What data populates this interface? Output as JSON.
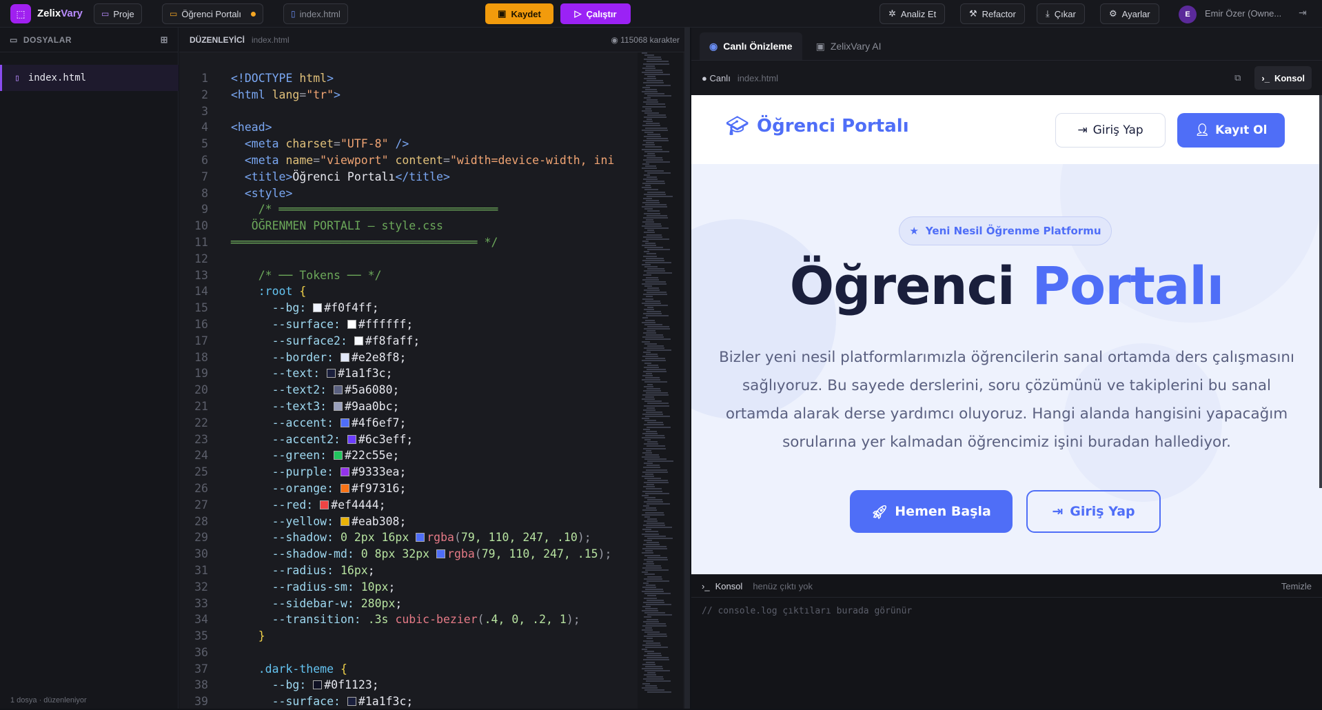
{
  "app": {
    "brand_a": "Zelix",
    "brand_b": "Vary"
  },
  "topbar": {
    "project_label": "Proje",
    "open_project": "Öğrenci Portalı",
    "open_file": "index.html",
    "save_label": "Kaydet",
    "run_label": "Çalıştır",
    "analyze_label": "Analiz Et",
    "refactor_label": "Refactor",
    "export_label": "Çıkar",
    "settings_label": "Ayarlar",
    "user_initial": "E",
    "user_name": "Emir Özer (Owne..."
  },
  "sidebar": {
    "title": "DOSYALAR",
    "files": [
      {
        "name": "index.html"
      }
    ],
    "footer": "1 dosya · düzenleniyor"
  },
  "editor": {
    "title": "DÜZENLEYİCİ",
    "file": "index.html",
    "char_count": "115068 karakter"
  },
  "code_lines": [
    [
      [
        "t-tag",
        "<!DOCTYPE "
      ],
      [
        "t-att",
        "html"
      ],
      [
        "t-tag",
        ">"
      ]
    ],
    [
      [
        "t-tag",
        "<html "
      ],
      [
        "t-att",
        "lang"
      ],
      [
        "t-pun",
        "="
      ],
      [
        "t-str",
        "\"tr\""
      ],
      [
        "t-tag",
        ">"
      ]
    ],
    [],
    [
      [
        "t-tag",
        "<head>"
      ]
    ],
    [
      [
        "t-txt",
        "  "
      ],
      [
        "t-tag",
        "<meta "
      ],
      [
        "t-att",
        "charset"
      ],
      [
        "t-pun",
        "="
      ],
      [
        "t-str",
        "\"UTF-8\""
      ],
      [
        "t-tag",
        " />"
      ]
    ],
    [
      [
        "t-txt",
        "  "
      ],
      [
        "t-tag",
        "<meta "
      ],
      [
        "t-att",
        "name"
      ],
      [
        "t-pun",
        "="
      ],
      [
        "t-str",
        "\"viewport\" "
      ],
      [
        "t-att",
        "content"
      ],
      [
        "t-pun",
        "="
      ],
      [
        "t-str",
        "\"width=device-width, ini"
      ]
    ],
    [
      [
        "t-txt",
        "  "
      ],
      [
        "t-tag",
        "<title>"
      ],
      [
        "t-txt",
        "Öğrenci Portalı"
      ],
      [
        "t-tag",
        "</title>"
      ]
    ],
    [
      [
        "t-txt",
        "  "
      ],
      [
        "t-tag",
        "<style>"
      ]
    ],
    [
      [
        "t-com",
        "    /* ════════════════════════════════"
      ]
    ],
    [
      [
        "t-com",
        "   ÖĞRENMEN PORTALI — style.css"
      ]
    ],
    [
      [
        "t-com",
        "════════════════════════════════════ */"
      ]
    ],
    [],
    [
      [
        "t-com",
        "    /* ── Tokens ── */"
      ]
    ],
    [
      [
        "t-sel",
        "    :root "
      ],
      [
        "t-br",
        "{"
      ]
    ],
    [
      [
        "t-prop",
        "      --bg: "
      ],
      [
        "sw",
        "#f0f4ff"
      ],
      [
        "t-txt",
        "#f0f4ff;"
      ]
    ],
    [
      [
        "t-prop",
        "      --surface: "
      ],
      [
        "sw",
        "#ffffff"
      ],
      [
        "t-txt",
        "#ffffff;"
      ]
    ],
    [
      [
        "t-prop",
        "      --surface2: "
      ],
      [
        "sw",
        "#f8faff"
      ],
      [
        "t-txt",
        "#f8faff;"
      ]
    ],
    [
      [
        "t-prop",
        "      --border: "
      ],
      [
        "sw",
        "#e2e8f8"
      ],
      [
        "t-txt",
        "#e2e8f8;"
      ]
    ],
    [
      [
        "t-prop",
        "      --text: "
      ],
      [
        "sw",
        "#1a1f3c"
      ],
      [
        "t-txt",
        "#1a1f3c;"
      ]
    ],
    [
      [
        "t-prop",
        "      --text2: "
      ],
      [
        "sw",
        "#5a6080"
      ],
      [
        "t-txt",
        "#5a6080;"
      ]
    ],
    [
      [
        "t-prop",
        "      --text3: "
      ],
      [
        "sw",
        "#9aa0bc"
      ],
      [
        "t-txt",
        "#9aa0bc;"
      ]
    ],
    [
      [
        "t-prop",
        "      --accent: "
      ],
      [
        "sw",
        "#4f6ef7"
      ],
      [
        "t-txt",
        "#4f6ef7;"
      ]
    ],
    [
      [
        "t-prop",
        "      --accent2: "
      ],
      [
        "sw",
        "#6c3eff"
      ],
      [
        "t-txt",
        "#6c3eff;"
      ]
    ],
    [
      [
        "t-prop",
        "      --green: "
      ],
      [
        "sw",
        "#22c55e"
      ],
      [
        "t-txt",
        "#22c55e;"
      ]
    ],
    [
      [
        "t-prop",
        "      --purple: "
      ],
      [
        "sw",
        "#9333ea"
      ],
      [
        "t-txt",
        "#9333ea;"
      ]
    ],
    [
      [
        "t-prop",
        "      --orange: "
      ],
      [
        "sw",
        "#f97316"
      ],
      [
        "t-txt",
        "#f97316;"
      ]
    ],
    [
      [
        "t-prop",
        "      --red: "
      ],
      [
        "sw",
        "#ef4444"
      ],
      [
        "t-txt",
        "#ef4444;"
      ]
    ],
    [
      [
        "t-prop",
        "      --yellow: "
      ],
      [
        "sw",
        "#eab308"
      ],
      [
        "t-txt",
        "#eab308;"
      ]
    ],
    [
      [
        "t-prop",
        "      --shadow: "
      ],
      [
        "t-num",
        "0 2px 16px "
      ],
      [
        "sw",
        "#4f6ef7"
      ],
      [
        "t-fn",
        "rgba"
      ],
      [
        "t-pun",
        "("
      ],
      [
        "t-num",
        "79, 110, 247, .10"
      ],
      [
        "t-pun",
        ");"
      ]
    ],
    [
      [
        "t-prop",
        "      --shadow-md: "
      ],
      [
        "t-num",
        "0 8px 32px "
      ],
      [
        "sw",
        "#4f6ef7"
      ],
      [
        "t-fn",
        "rgba"
      ],
      [
        "t-pun",
        "("
      ],
      [
        "t-num",
        "79, 110, 247, .15"
      ],
      [
        "t-pun",
        ");"
      ]
    ],
    [
      [
        "t-prop",
        "      --radius: "
      ],
      [
        "t-num",
        "16px"
      ],
      [
        "t-txt",
        ";"
      ]
    ],
    [
      [
        "t-prop",
        "      --radius-sm: "
      ],
      [
        "t-num",
        "10px"
      ],
      [
        "t-txt",
        ";"
      ]
    ],
    [
      [
        "t-prop",
        "      --sidebar-w: "
      ],
      [
        "t-num",
        "280px"
      ],
      [
        "t-txt",
        ";"
      ]
    ],
    [
      [
        "t-prop",
        "      --transition: "
      ],
      [
        "t-num",
        ".3s "
      ],
      [
        "t-fn",
        "cubic-bezier"
      ],
      [
        "t-pun",
        "("
      ],
      [
        "t-num",
        ".4, 0, .2, 1"
      ],
      [
        "t-pun",
        ");"
      ]
    ],
    [
      [
        "t-br",
        "    }"
      ]
    ],
    [],
    [
      [
        "t-sel",
        "    .dark-theme "
      ],
      [
        "t-br",
        "{"
      ]
    ],
    [
      [
        "t-prop",
        "      --bg: "
      ],
      [
        "sw",
        "#0f1123"
      ],
      [
        "t-txt",
        "#0f1123;"
      ]
    ],
    [
      [
        "t-prop",
        "      --surface: "
      ],
      [
        "sw",
        "#1a1f3c"
      ],
      [
        "t-txt",
        "#1a1f3c;"
      ]
    ]
  ],
  "preview": {
    "tab_live": "Canlı Önizleme",
    "tab_ai": "ZelixVary AI",
    "status_live": "● Canlı",
    "status_file": "index.html",
    "console_button": "Konsol",
    "site": {
      "logo": "Öğrenci Portalı",
      "login": "Giriş Yap",
      "register": "Kayıt Ol",
      "badge": "Yeni Nesil Öğrenme Platformu",
      "hero_a": "Öğrenci ",
      "hero_b": "Portalı",
      "description": "Bizler yeni nesil platformlarımızla öğrencilerin sanal ortamda ders çalışmasını sağlıyoruz. Bu sayede derslerini, soru çözümünü ve takiplerini bu sanal ortamda alarak derse yardımcı oluyoruz. Hangi alanda hangisini yapacağım sorularına yer kalmadan öğrencimiz işini buradan hallediyor.",
      "cta_primary": "Hemen Başla",
      "cta_secondary": "Giriş Yap"
    },
    "console": {
      "title": "Konsol",
      "status": "henüz çıktı yok",
      "clear": "Temizle",
      "placeholder": "// console.log çıktıları burada görünür"
    }
  }
}
